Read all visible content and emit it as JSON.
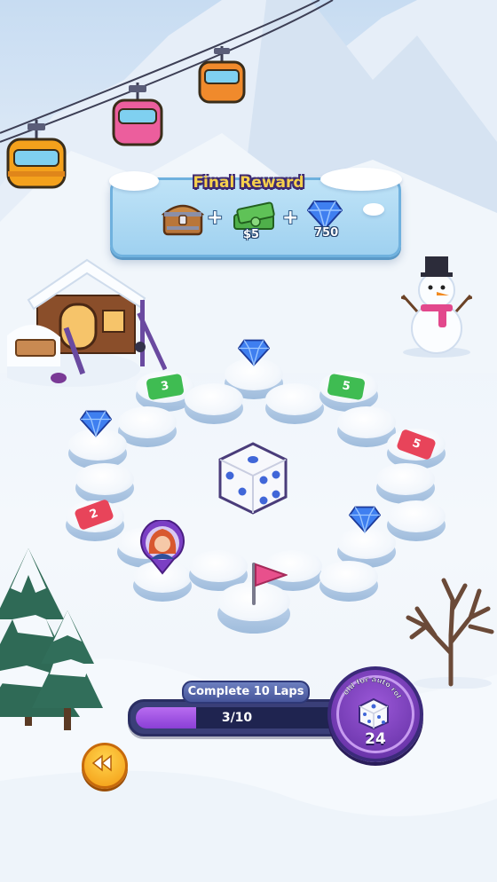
{
  "final_reward": {
    "title": "Final Reward",
    "cash_label": "$5",
    "gems_label": "750",
    "plus": "+"
  },
  "board": {
    "arrow_badges": [
      "3",
      "5",
      "5",
      "2"
    ]
  },
  "progress": {
    "title": "Complete 10 Laps",
    "text": "3/10",
    "fraction": 0.3
  },
  "roll_button": {
    "label": "Hold for auto roll",
    "count": "24"
  },
  "icons": {
    "back": "rewind-icon",
    "chest": "treasure-chest-icon",
    "cash": "cash-stack-icon",
    "gem": "blue-gem-icon",
    "dice": "dice-icon",
    "flag": "pink-flag-icon",
    "avatar": "player-avatar-pin"
  },
  "colors": {
    "progress_fill": "#8a3fd6",
    "title_gold": "#f6d04d",
    "roll_button": "#6a33b0"
  }
}
